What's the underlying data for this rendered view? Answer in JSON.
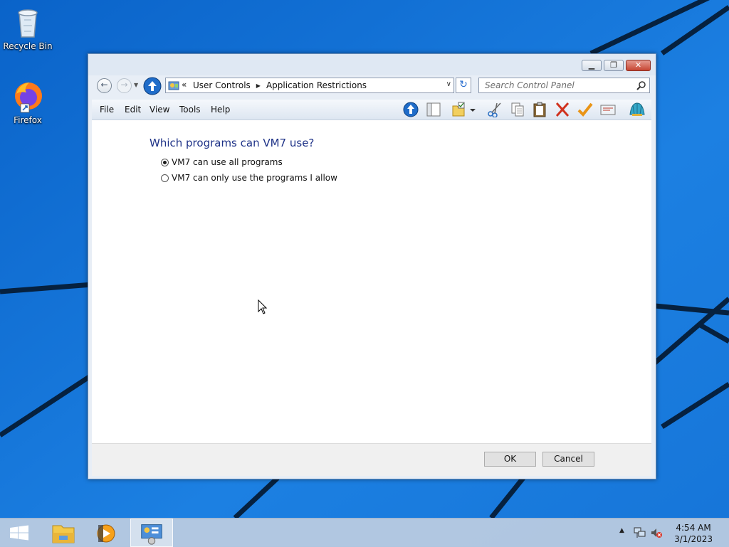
{
  "desktop": {
    "icons": [
      {
        "label": "Recycle Bin",
        "icon": "recycle-bin-icon"
      },
      {
        "label": "Firefox",
        "icon": "firefox-icon"
      }
    ]
  },
  "window": {
    "caption_buttons": {
      "minimize": "minimize-icon",
      "restore": "restore-icon",
      "close": "close-icon"
    },
    "nav": {
      "breadcrumb_overflow": "«",
      "breadcrumb": [
        "User Controls",
        "Application Restrictions"
      ],
      "search_placeholder": "Search Control Panel"
    },
    "menu": [
      "File",
      "Edit",
      "View",
      "Tools",
      "Help"
    ],
    "toolbar_icons": [
      "up-arrow-icon",
      "panel-icon",
      "folder-icon",
      "dropdown-arrow-icon",
      "cut-icon",
      "copy-icon",
      "paste-icon",
      "delete-icon",
      "checkmark-icon",
      "properties-icon",
      "shell-icon"
    ],
    "content": {
      "heading": "Which programs can VM7 use?",
      "options": [
        {
          "label": "VM7 can use all programs",
          "selected": true
        },
        {
          "label": "VM7 can only use the programs I allow",
          "selected": false
        }
      ]
    },
    "buttons": {
      "ok": "OK",
      "cancel": "Cancel"
    }
  },
  "taskbar": {
    "apps": [
      "start-icon",
      "file-explorer-icon",
      "media-player-icon",
      "control-panel-icon"
    ],
    "tray": {
      "time": "4:54 AM",
      "date": "3/1/2023"
    }
  },
  "colors": {
    "wallpaper": "#1170d6",
    "heading": "#1e3287",
    "window_frame": "#e8eef6"
  }
}
